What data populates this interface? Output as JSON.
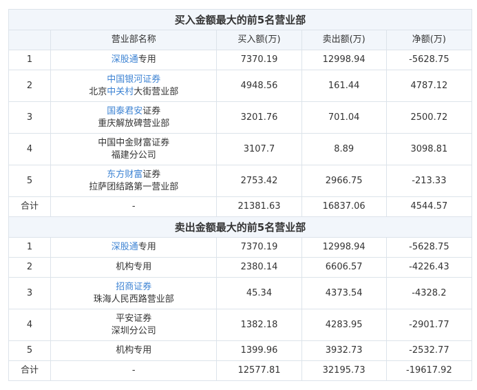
{
  "buy_title": "买入金额最大的前5名营业部",
  "sell_title": "卖出金额最大的前5名营业部",
  "headers": [
    "营业部名称",
    "买入额(万)",
    "卖出额(万)",
    "净额(万)"
  ],
  "buy_rows": [
    {
      "idx": "1",
      "n1": [
        {
          "t": "深股通",
          "link": true
        },
        {
          "t": "专用",
          "link": false
        }
      ],
      "n2": [],
      "buy": "7370.19",
      "sell": "12998.94",
      "net": "-5628.75"
    },
    {
      "idx": "2",
      "n1": [
        {
          "t": "中国银河证券",
          "link": true
        }
      ],
      "n2": [
        {
          "t": "北京",
          "link": false
        },
        {
          "t": "中关村",
          "link": true
        },
        {
          "t": "大街营业部",
          "link": false
        }
      ],
      "buy": "4948.56",
      "sell": "161.44",
      "net": "4787.12"
    },
    {
      "idx": "3",
      "n1": [
        {
          "t": "国泰君安",
          "link": true
        },
        {
          "t": "证券",
          "link": false
        }
      ],
      "n2": [
        {
          "t": "重庆解放碑营业部",
          "link": false
        }
      ],
      "buy": "3201.76",
      "sell": "701.04",
      "net": "2500.72"
    },
    {
      "idx": "4",
      "n1": [
        {
          "t": "中国中金财富证券",
          "link": false
        }
      ],
      "n2": [
        {
          "t": "福建分公司",
          "link": false
        }
      ],
      "buy": "3107.7",
      "sell": "8.89",
      "net": "3098.81"
    },
    {
      "idx": "5",
      "n1": [
        {
          "t": "东方财富",
          "link": true
        },
        {
          "t": "证券",
          "link": false
        }
      ],
      "n2": [
        {
          "t": "拉萨团结路第一营业部",
          "link": false
        }
      ],
      "buy": "2753.42",
      "sell": "2966.75",
      "net": "-213.33"
    }
  ],
  "buy_total": {
    "label": "合计",
    "name": "-",
    "buy": "21381.63",
    "sell": "16837.06",
    "net": "4544.57"
  },
  "sell_rows": [
    {
      "idx": "1",
      "n1": [
        {
          "t": "深股通",
          "link": true
        },
        {
          "t": "专用",
          "link": false
        }
      ],
      "n2": [],
      "buy": "7370.19",
      "sell": "12998.94",
      "net": "-5628.75"
    },
    {
      "idx": "2",
      "n1": [
        {
          "t": "机构专用",
          "link": false
        }
      ],
      "n2": [],
      "buy": "2380.14",
      "sell": "6606.57",
      "net": "-4226.43"
    },
    {
      "idx": "3",
      "n1": [
        {
          "t": "招商证券",
          "link": true
        }
      ],
      "n2": [
        {
          "t": "珠海人民西路营业部",
          "link": false
        }
      ],
      "buy": "45.34",
      "sell": "4373.54",
      "net": "-4328.2"
    },
    {
      "idx": "4",
      "n1": [
        {
          "t": "平安证券",
          "link": false
        }
      ],
      "n2": [
        {
          "t": "深圳分公司",
          "link": false
        }
      ],
      "buy": "1382.18",
      "sell": "4283.95",
      "net": "-2901.77"
    },
    {
      "idx": "5",
      "n1": [
        {
          "t": "机构专用",
          "link": false
        }
      ],
      "n2": [],
      "buy": "1399.96",
      "sell": "3932.73",
      "net": "-2532.77"
    }
  ],
  "sell_total": {
    "label": "合计",
    "name": "-",
    "buy": "12577.81",
    "sell": "32195.73",
    "net": "-19617.92"
  }
}
